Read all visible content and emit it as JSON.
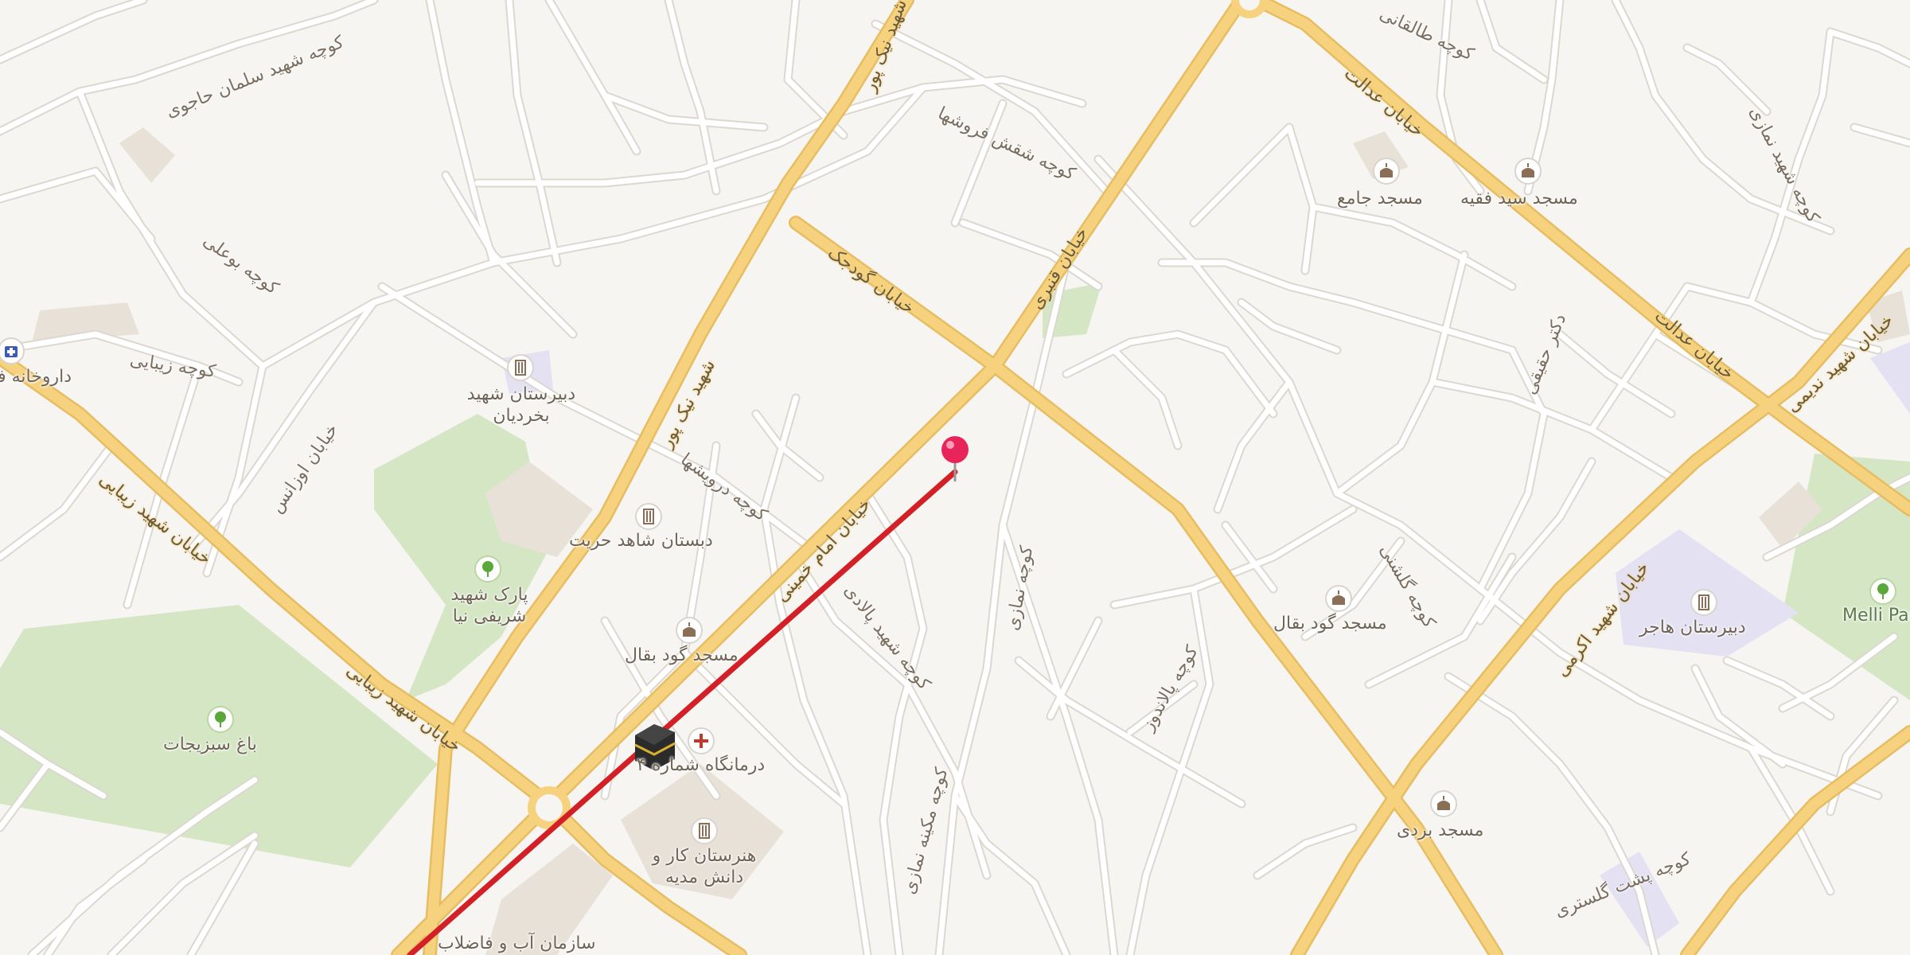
{
  "colors": {
    "background": "#f7f5f2",
    "minor_road": "#ffffff",
    "minor_road_casing": "#dcd7cf",
    "major_road": "#f6d27e",
    "major_road_casing": "#e6bd62",
    "park": "#d5e6c4",
    "school_area": "#e4e1f3",
    "building": "#e8e1d8",
    "route_line": "#d32027",
    "marker_pin": "#e8255b"
  },
  "pois": [
    {
      "name": "مسجد جامع",
      "icon": "mosque-icon"
    },
    {
      "name": "مسجد سید فقیه",
      "icon": "mosque-icon"
    },
    {
      "name": "دبیرستان شهید بخردیان",
      "icon": "school-icon"
    },
    {
      "name": "دبستان شاهد حریت",
      "icon": "school-icon"
    },
    {
      "name": "پارک شهید شریفی نیا",
      "icon": "tree-icon"
    },
    {
      "name": "باغ سبزیجات",
      "icon": "tree-icon"
    },
    {
      "name": "مسجد گود بقال",
      "icon": "mosque-icon"
    },
    {
      "name": "درمانگاه شماره ۴",
      "icon": "hospital-icon"
    },
    {
      "name": "هنرستان کار و دانش مدیه",
      "icon": "school-icon"
    },
    {
      "name": "سازمان آب و فاضلاب",
      "icon": ""
    },
    {
      "name": "مسجد گود بقال",
      "icon": "mosque-icon"
    },
    {
      "name": "مسجد بردی",
      "icon": "mosque-icon"
    },
    {
      "name": "دبیرستان هاجر",
      "icon": "school-icon"
    },
    {
      "name": "Melli Park",
      "icon": "tree-icon"
    },
    {
      "name": "داروخانه فارابی",
      "icon": "pharmacy-icon"
    }
  ],
  "streets": [
    "کوچه شهید سلمان حاجوی",
    "کوچه شقش فروشها",
    "خیابان عدالت",
    "خیابان عدالت",
    "خیابان گودجک",
    "خیابان قنبری",
    "کوچه بوعلی",
    "کوچه زیبایی",
    "خیابان شهید زیبایی",
    "خیابان شهید زیبایی",
    "کوچه درویشها",
    "شهید نیک پور",
    "خیابان اوزانس",
    "خیابان امام خمینی",
    "کوچه شهید پالادی",
    "کوچه نمازی",
    "کوچه مکینه نمازی",
    "کوچه پالاندوز",
    "کوچه گلشنی",
    "دکتر حقیقی",
    "کوچه پشت گلستری",
    "خیابان شهید ندیمی",
    "خیابان شهید اکرمی",
    "کوچه شهید نمازی",
    "کوچه طالقانی",
    "شهید نیک پور"
  ]
}
